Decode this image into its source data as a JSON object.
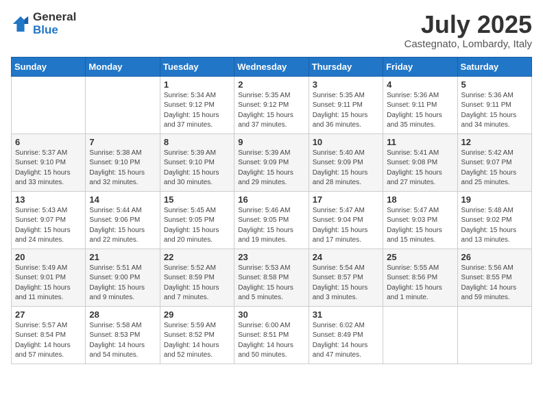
{
  "logo": {
    "general": "General",
    "blue": "Blue"
  },
  "title": "July 2025",
  "location": "Castegnato, Lombardy, Italy",
  "days_of_week": [
    "Sunday",
    "Monday",
    "Tuesday",
    "Wednesday",
    "Thursday",
    "Friday",
    "Saturday"
  ],
  "weeks": [
    [
      {
        "day": "",
        "sunrise": "",
        "sunset": "",
        "daylight": ""
      },
      {
        "day": "",
        "sunrise": "",
        "sunset": "",
        "daylight": ""
      },
      {
        "day": "1",
        "sunrise": "Sunrise: 5:34 AM",
        "sunset": "Sunset: 9:12 PM",
        "daylight": "Daylight: 15 hours and 37 minutes."
      },
      {
        "day": "2",
        "sunrise": "Sunrise: 5:35 AM",
        "sunset": "Sunset: 9:12 PM",
        "daylight": "Daylight: 15 hours and 37 minutes."
      },
      {
        "day": "3",
        "sunrise": "Sunrise: 5:35 AM",
        "sunset": "Sunset: 9:11 PM",
        "daylight": "Daylight: 15 hours and 36 minutes."
      },
      {
        "day": "4",
        "sunrise": "Sunrise: 5:36 AM",
        "sunset": "Sunset: 9:11 PM",
        "daylight": "Daylight: 15 hours and 35 minutes."
      },
      {
        "day": "5",
        "sunrise": "Sunrise: 5:36 AM",
        "sunset": "Sunset: 9:11 PM",
        "daylight": "Daylight: 15 hours and 34 minutes."
      }
    ],
    [
      {
        "day": "6",
        "sunrise": "Sunrise: 5:37 AM",
        "sunset": "Sunset: 9:10 PM",
        "daylight": "Daylight: 15 hours and 33 minutes."
      },
      {
        "day": "7",
        "sunrise": "Sunrise: 5:38 AM",
        "sunset": "Sunset: 9:10 PM",
        "daylight": "Daylight: 15 hours and 32 minutes."
      },
      {
        "day": "8",
        "sunrise": "Sunrise: 5:39 AM",
        "sunset": "Sunset: 9:10 PM",
        "daylight": "Daylight: 15 hours and 30 minutes."
      },
      {
        "day": "9",
        "sunrise": "Sunrise: 5:39 AM",
        "sunset": "Sunset: 9:09 PM",
        "daylight": "Daylight: 15 hours and 29 minutes."
      },
      {
        "day": "10",
        "sunrise": "Sunrise: 5:40 AM",
        "sunset": "Sunset: 9:09 PM",
        "daylight": "Daylight: 15 hours and 28 minutes."
      },
      {
        "day": "11",
        "sunrise": "Sunrise: 5:41 AM",
        "sunset": "Sunset: 9:08 PM",
        "daylight": "Daylight: 15 hours and 27 minutes."
      },
      {
        "day": "12",
        "sunrise": "Sunrise: 5:42 AM",
        "sunset": "Sunset: 9:07 PM",
        "daylight": "Daylight: 15 hours and 25 minutes."
      }
    ],
    [
      {
        "day": "13",
        "sunrise": "Sunrise: 5:43 AM",
        "sunset": "Sunset: 9:07 PM",
        "daylight": "Daylight: 15 hours and 24 minutes."
      },
      {
        "day": "14",
        "sunrise": "Sunrise: 5:44 AM",
        "sunset": "Sunset: 9:06 PM",
        "daylight": "Daylight: 15 hours and 22 minutes."
      },
      {
        "day": "15",
        "sunrise": "Sunrise: 5:45 AM",
        "sunset": "Sunset: 9:05 PM",
        "daylight": "Daylight: 15 hours and 20 minutes."
      },
      {
        "day": "16",
        "sunrise": "Sunrise: 5:46 AM",
        "sunset": "Sunset: 9:05 PM",
        "daylight": "Daylight: 15 hours and 19 minutes."
      },
      {
        "day": "17",
        "sunrise": "Sunrise: 5:47 AM",
        "sunset": "Sunset: 9:04 PM",
        "daylight": "Daylight: 15 hours and 17 minutes."
      },
      {
        "day": "18",
        "sunrise": "Sunrise: 5:47 AM",
        "sunset": "Sunset: 9:03 PM",
        "daylight": "Daylight: 15 hours and 15 minutes."
      },
      {
        "day": "19",
        "sunrise": "Sunrise: 5:48 AM",
        "sunset": "Sunset: 9:02 PM",
        "daylight": "Daylight: 15 hours and 13 minutes."
      }
    ],
    [
      {
        "day": "20",
        "sunrise": "Sunrise: 5:49 AM",
        "sunset": "Sunset: 9:01 PM",
        "daylight": "Daylight: 15 hours and 11 minutes."
      },
      {
        "day": "21",
        "sunrise": "Sunrise: 5:51 AM",
        "sunset": "Sunset: 9:00 PM",
        "daylight": "Daylight: 15 hours and 9 minutes."
      },
      {
        "day": "22",
        "sunrise": "Sunrise: 5:52 AM",
        "sunset": "Sunset: 8:59 PM",
        "daylight": "Daylight: 15 hours and 7 minutes."
      },
      {
        "day": "23",
        "sunrise": "Sunrise: 5:53 AM",
        "sunset": "Sunset: 8:58 PM",
        "daylight": "Daylight: 15 hours and 5 minutes."
      },
      {
        "day": "24",
        "sunrise": "Sunrise: 5:54 AM",
        "sunset": "Sunset: 8:57 PM",
        "daylight": "Daylight: 15 hours and 3 minutes."
      },
      {
        "day": "25",
        "sunrise": "Sunrise: 5:55 AM",
        "sunset": "Sunset: 8:56 PM",
        "daylight": "Daylight: 15 hours and 1 minute."
      },
      {
        "day": "26",
        "sunrise": "Sunrise: 5:56 AM",
        "sunset": "Sunset: 8:55 PM",
        "daylight": "Daylight: 14 hours and 59 minutes."
      }
    ],
    [
      {
        "day": "27",
        "sunrise": "Sunrise: 5:57 AM",
        "sunset": "Sunset: 8:54 PM",
        "daylight": "Daylight: 14 hours and 57 minutes."
      },
      {
        "day": "28",
        "sunrise": "Sunrise: 5:58 AM",
        "sunset": "Sunset: 8:53 PM",
        "daylight": "Daylight: 14 hours and 54 minutes."
      },
      {
        "day": "29",
        "sunrise": "Sunrise: 5:59 AM",
        "sunset": "Sunset: 8:52 PM",
        "daylight": "Daylight: 14 hours and 52 minutes."
      },
      {
        "day": "30",
        "sunrise": "Sunrise: 6:00 AM",
        "sunset": "Sunset: 8:51 PM",
        "daylight": "Daylight: 14 hours and 50 minutes."
      },
      {
        "day": "31",
        "sunrise": "Sunrise: 6:02 AM",
        "sunset": "Sunset: 8:49 PM",
        "daylight": "Daylight: 14 hours and 47 minutes."
      },
      {
        "day": "",
        "sunrise": "",
        "sunset": "",
        "daylight": ""
      },
      {
        "day": "",
        "sunrise": "",
        "sunset": "",
        "daylight": ""
      }
    ]
  ]
}
